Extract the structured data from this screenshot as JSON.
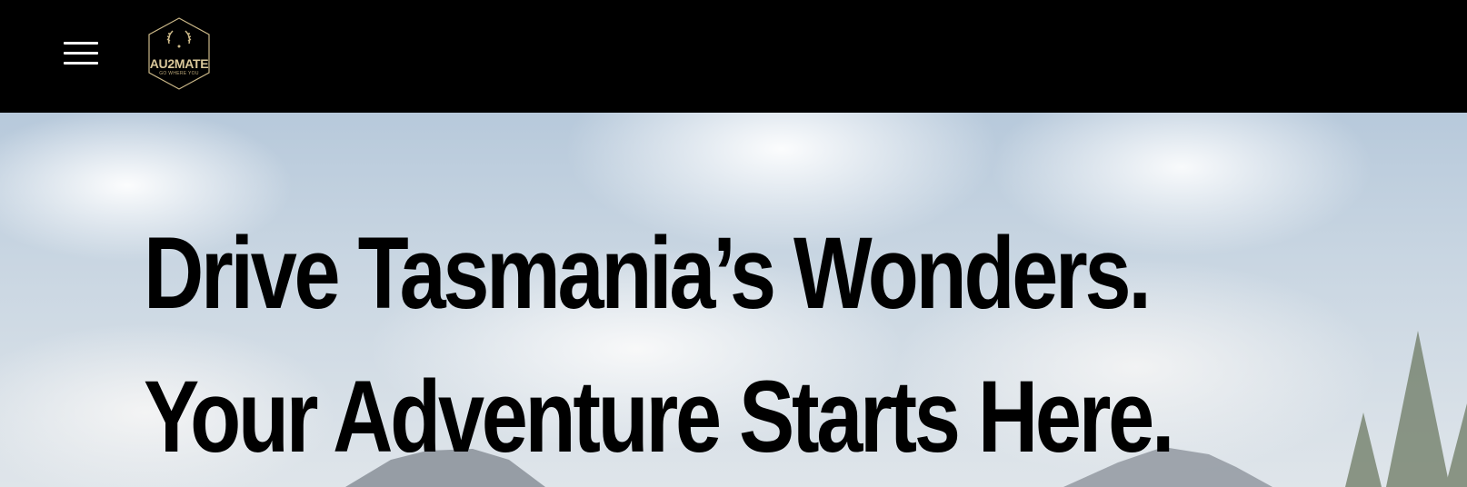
{
  "header": {
    "menu_icon": "hamburger-menu-icon",
    "logo": {
      "name": "AU2MATE",
      "tagline": "GO WHERE YOU",
      "color": "#d9c79a"
    }
  },
  "hero": {
    "headline_line1": "Drive Tasmania’s Wonders.",
    "headline_line2": "Your Adventure Starts Here."
  }
}
